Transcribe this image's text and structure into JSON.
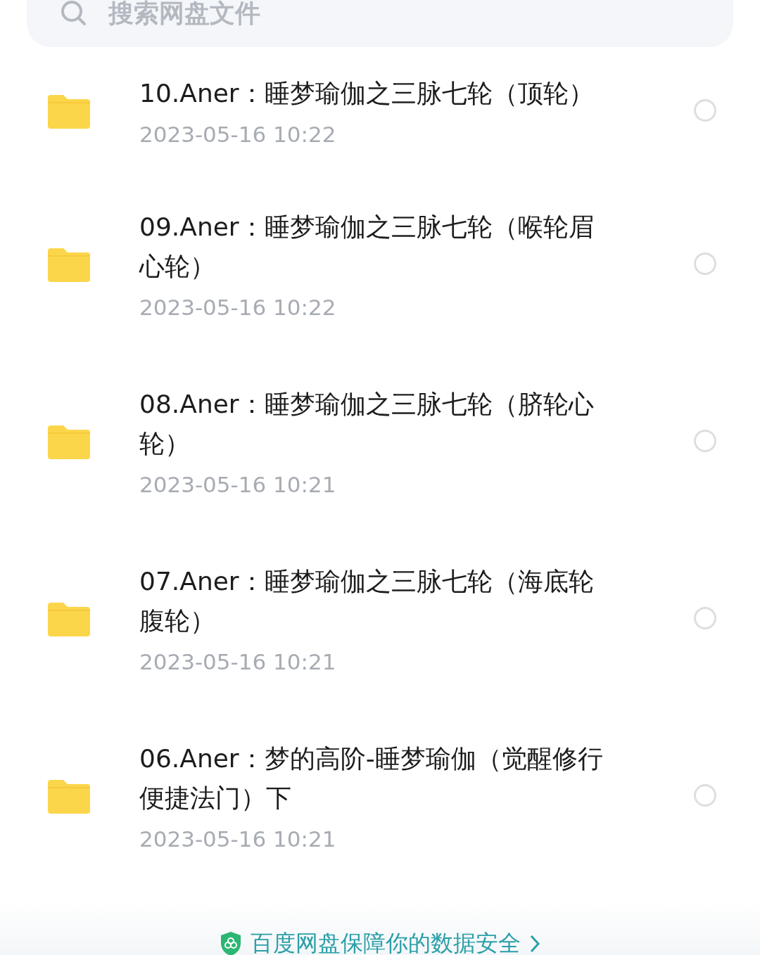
{
  "search": {
    "placeholder": "搜索网盘文件"
  },
  "files": [
    {
      "name": "10.Aner：睡梦瑜伽之三脉七轮（顶轮）",
      "date": "2023-05-16  10:22",
      "selected": false
    },
    {
      "name": "09.Aner：睡梦瑜伽之三脉七轮（喉轮眉心轮）",
      "date": "2023-05-16  10:22",
      "selected": false
    },
    {
      "name": "08.Aner：睡梦瑜伽之三脉七轮（脐轮心轮）",
      "date": "2023-05-16  10:21",
      "selected": false
    },
    {
      "name": "07.Aner：睡梦瑜伽之三脉七轮（海底轮腹轮）",
      "date": "2023-05-16  10:21",
      "selected": false
    },
    {
      "name": "06.Aner：梦的高阶-睡梦瑜伽（觉醒修行便捷法门）下",
      "date": "2023-05-16  10:21",
      "selected": false
    }
  ],
  "footer": {
    "link": "百度网盘保障你的数据安全"
  }
}
